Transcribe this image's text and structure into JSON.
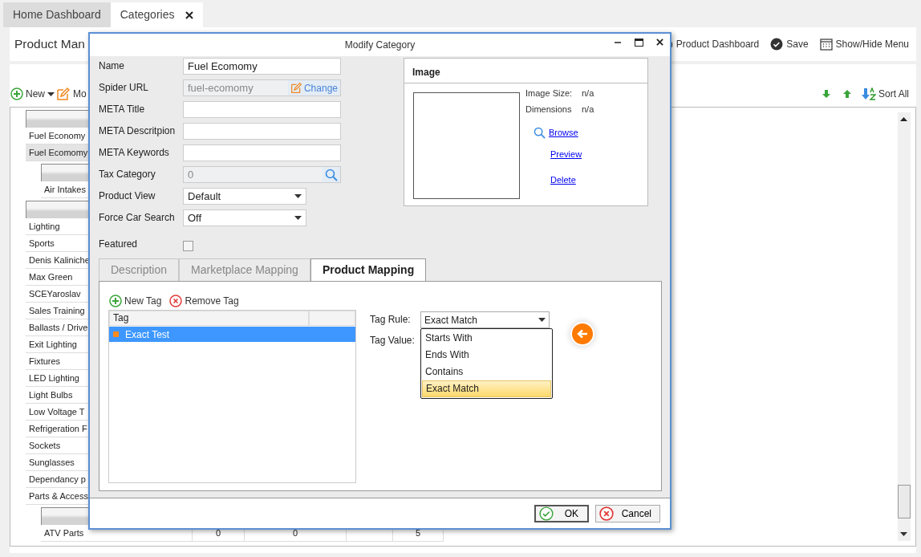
{
  "tabs": [
    {
      "label": "Home Dashboard",
      "selected": false
    },
    {
      "label": "Categories",
      "selected": true
    }
  ],
  "page": {
    "title": "Product Man",
    "actions": [
      {
        "kind": "dashboard",
        "label": "Product Dashboard"
      },
      {
        "kind": "save",
        "label": "Save"
      },
      {
        "kind": "menu",
        "label": "Show/Hide Menu"
      }
    ]
  },
  "toolbar": {
    "left": [
      {
        "kind": "new",
        "label": "New"
      },
      {
        "kind": "modify",
        "label": "Mo"
      }
    ],
    "right": [
      {
        "kind": "down"
      },
      {
        "kind": "up"
      },
      {
        "kind": "sort",
        "label": "Sort All"
      }
    ]
  },
  "tree": [
    {
      "rows": [
        {
          "label": "Fuel Economy",
          "selected": false
        },
        {
          "label": "Fuel Ecomomy",
          "selected": true
        }
      ],
      "children": [
        {
          "rows": [
            {
              "label": "Air Intakes",
              "selected": false
            }
          ]
        }
      ]
    },
    {
      "rows": [
        {
          "label": "Lighting",
          "selected": false
        },
        {
          "label": "Sports",
          "selected": false
        },
        {
          "label": "Denis Kaliniche",
          "selected": false
        },
        {
          "label": "Max Green",
          "selected": false
        },
        {
          "label": "SCEYaroslav",
          "selected": false
        },
        {
          "label": "Sales Training",
          "selected": false
        },
        {
          "label": "Ballasts / Drive",
          "selected": false
        },
        {
          "label": "Exit Lighting",
          "selected": false
        },
        {
          "label": "Fixtures",
          "selected": false
        },
        {
          "label": "LED Lighting",
          "selected": false
        },
        {
          "label": "Light Bulbs",
          "selected": false
        },
        {
          "label": "Low Voltage T",
          "selected": false
        },
        {
          "label": "Refrigeration F",
          "selected": false
        },
        {
          "label": "Sockets",
          "selected": false
        },
        {
          "label": "Sunglasses",
          "selected": false
        },
        {
          "label": "Dependancy p",
          "selected": false
        },
        {
          "label": "Parts & Access",
          "selected": false
        }
      ],
      "children": [
        {
          "rows": [
            {
              "label": "ATV Parts",
              "selected": false,
              "column_2": "0",
              "column_3": "0",
              "column_5": "5"
            }
          ]
        }
      ]
    }
  ],
  "dialog": {
    "title": "Modify Category",
    "fields": [
      {
        "kind": "text",
        "label": "Name",
        "value": "Fuel Ecomomy"
      },
      {
        "kind": "url",
        "label": "Spider URL",
        "value": "fuel-ecomomy",
        "button": "Change"
      },
      {
        "kind": "text",
        "label": "META Title"
      },
      {
        "kind": "text",
        "label": "META Descritpion"
      },
      {
        "kind": "text",
        "label": "META Keywords"
      },
      {
        "kind": "lookup",
        "label": "Tax Category",
        "value": "0"
      },
      {
        "kind": "select",
        "label": "Product View",
        "value": "Default"
      },
      {
        "kind": "select",
        "label": "Force Car Search",
        "value": "Off"
      },
      {
        "kind": "checkbox",
        "label": "Featured",
        "checked": false
      }
    ],
    "image": {
      "title": "Image",
      "info": [
        {
          "label": "Image Size:",
          "value": "n/a"
        },
        {
          "label": "Dimensions",
          "value": "n/a"
        }
      ],
      "links": [
        {
          "kind": "browse",
          "label": "Browse"
        },
        {
          "kind": "plain",
          "label": "Preview"
        },
        {
          "kind": "plain",
          "label": "Delete"
        }
      ]
    },
    "tabs": [
      {
        "label": "Description",
        "selected": false
      },
      {
        "label": "Marketplace Mapping",
        "selected": false
      },
      {
        "label": "Product Mapping",
        "selected": true
      }
    ],
    "tag_toolbar": [
      {
        "kind": "add",
        "label": "New Tag"
      },
      {
        "kind": "remove",
        "label": "Remove Tag"
      }
    ],
    "tag_grid": {
      "columns": [
        "Tag"
      ],
      "rows": [
        {
          "label": "Exact Test",
          "selected": true
        }
      ]
    },
    "tag_rule": {
      "label": "Tag Rule:",
      "value": "Exact Match",
      "expanded": true,
      "options": [
        {
          "label": "Starts With",
          "selected": false
        },
        {
          "label": "Ends With",
          "selected": false
        },
        {
          "label": "Contains",
          "selected": false
        },
        {
          "label": "Exact Match",
          "selected": true
        }
      ]
    },
    "tag_value": {
      "label": "Tag Value:"
    },
    "buttons": [
      {
        "kind": "ok",
        "label": "OK"
      },
      {
        "kind": "cancel",
        "label": "Cancel"
      }
    ]
  }
}
